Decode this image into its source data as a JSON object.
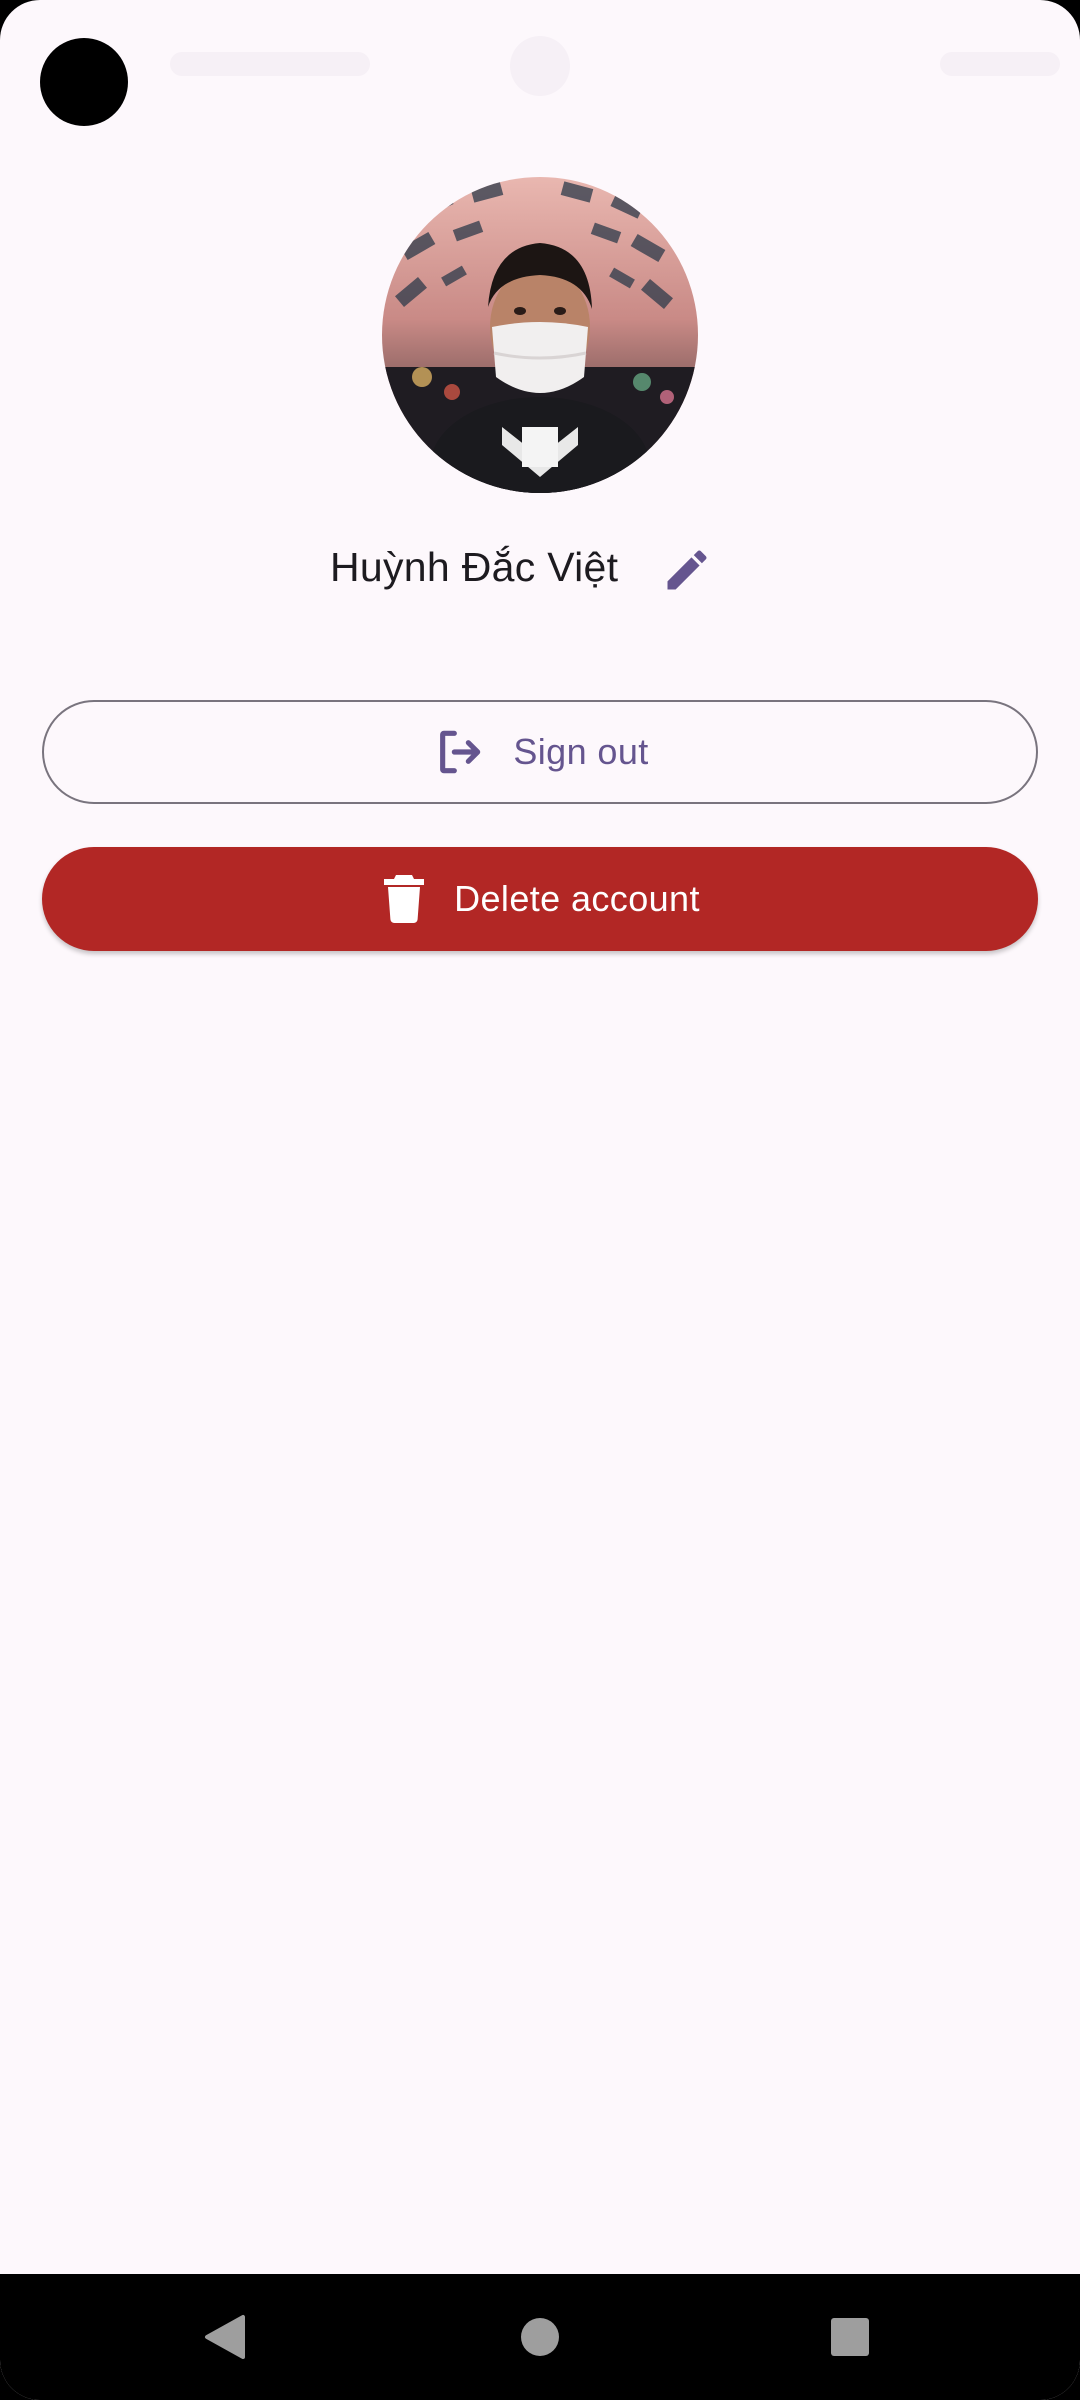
{
  "profile": {
    "user_name": "Huỳnh Đắc Việt"
  },
  "actions": {
    "sign_out_label": "Sign out",
    "delete_account_label": "Delete account"
  },
  "colors": {
    "background": "#fdf8fc",
    "primary": "#65558f",
    "danger": "#b22725",
    "outline": "#79747e"
  },
  "icons": {
    "edit": "pencil-icon",
    "sign_out": "logout-icon",
    "delete": "trash-icon",
    "nav_back": "back-triangle-icon",
    "nav_home": "home-circle-icon",
    "nav_recents": "recents-square-icon"
  }
}
